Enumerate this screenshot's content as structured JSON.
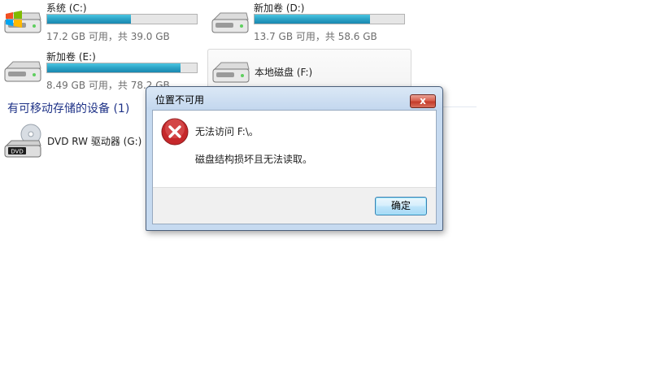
{
  "drives": [
    {
      "name": "系统 (C:)",
      "free": "17.2 GB 可用，共 39.0 GB",
      "used_fraction": 0.56,
      "has_windows_logo": true
    },
    {
      "name": "新加卷 (D:)",
      "free": "13.7 GB 可用，共 58.6 GB",
      "used_fraction": 0.77,
      "has_windows_logo": false
    },
    {
      "name": "新加卷 (E:)",
      "free": "8.49 GB 可用，共 78.2 GB",
      "used_fraction": 0.89,
      "has_windows_logo": false
    },
    {
      "name": "本地磁盘 (F:)"
    }
  ],
  "removable_group": {
    "title": "有可移动存储的设备 (1)"
  },
  "dvd": {
    "name": "DVD RW 驱动器 (G:)",
    "badge": "DVD"
  },
  "dialog": {
    "title": "位置不可用",
    "close_label": "x",
    "message_line1": "无法访问 F:\\。",
    "message_line2": "磁盘结构损坏且无法读取。",
    "ok_label": "确定"
  },
  "colors": {
    "bar_fill": "#2ea6c8",
    "group_title": "#1e3287",
    "dialog_frame": "#c6daf0",
    "close_button": "#c43b2a",
    "error_icon": "#c6282b"
  }
}
